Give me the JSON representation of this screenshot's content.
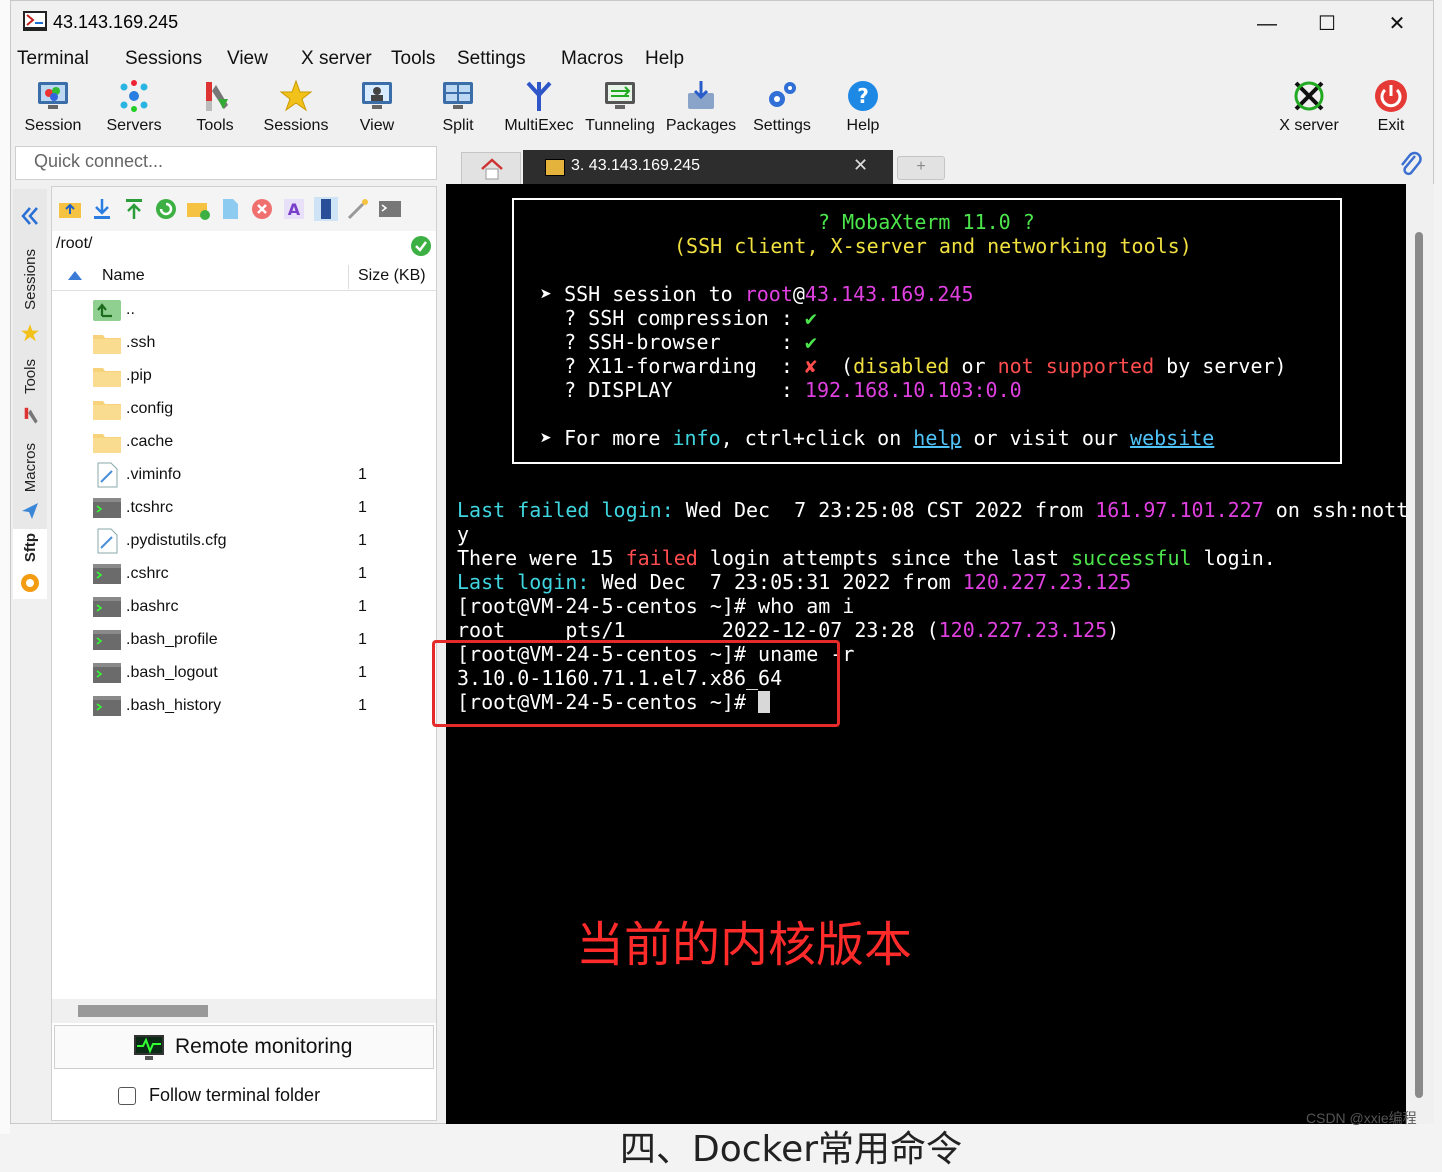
{
  "window": {
    "title": "43.143.169.245",
    "minimize": "—",
    "maximize": "☐",
    "close": "✕"
  },
  "menu": [
    "Terminal",
    "Sessions",
    "View",
    "X server",
    "Tools",
    "Settings",
    "Macros",
    "Help"
  ],
  "toolbar": {
    "session": "Session",
    "servers": "Servers",
    "tools": "Tools",
    "sessions": "Sessions",
    "view": "View",
    "split": "Split",
    "multiexec": "MultiExec",
    "tunneling": "Tunneling",
    "packages": "Packages",
    "settings": "Settings",
    "help": "Help",
    "xserver": "X server",
    "exit": "Exit"
  },
  "quick_connect": {
    "placeholder": "Quick connect..."
  },
  "side_tabs": [
    "Sessions",
    "Tools",
    "Macros",
    "Sftp"
  ],
  "sftp": {
    "path": "/root/",
    "col_name": "Name",
    "col_size": "Size (KB)",
    "files": [
      {
        "name": "..",
        "size": "",
        "type": "up"
      },
      {
        "name": ".ssh",
        "size": "",
        "type": "folder"
      },
      {
        "name": ".pip",
        "size": "",
        "type": "folder"
      },
      {
        "name": ".config",
        "size": "",
        "type": "folder"
      },
      {
        "name": ".cache",
        "size": "",
        "type": "folder"
      },
      {
        "name": ".viminfo",
        "size": "1",
        "type": "doc"
      },
      {
        "name": ".tcshrc",
        "size": "1",
        "type": "shell"
      },
      {
        "name": ".pydistutils.cfg",
        "size": "1",
        "type": "doc"
      },
      {
        "name": ".cshrc",
        "size": "1",
        "type": "shell"
      },
      {
        "name": ".bashrc",
        "size": "1",
        "type": "shell"
      },
      {
        "name": ".bash_profile",
        "size": "1",
        "type": "shell"
      },
      {
        "name": ".bash_logout",
        "size": "1",
        "type": "shell"
      },
      {
        "name": ".bash_history",
        "size": "1",
        "type": "shell"
      }
    ],
    "remote_monitoring": "Remote monitoring",
    "follow_folder": "Follow terminal folder"
  },
  "tab": {
    "title": "3. 43.143.169.245",
    "close": "✕",
    "new": "+"
  },
  "terminal": {
    "banner_title": "? MobaXterm 11.0 ?",
    "banner_sub": "(SSH client, X-server and networking tools)",
    "ssh_to": "➤ SSH session to ",
    "ssh_user": "root",
    "ssh_at": "@",
    "ssh_host": "43.143.169.245",
    "compression_label": "  ? SSH compression : ",
    "browser_label": "  ? SSH-browser     : ",
    "check": "✔",
    "x11_label": "  ? X11-forwarding  : ",
    "cross": "✘",
    "x11_open": "  (",
    "x11_disabled": "disabled",
    "x11_or": " or ",
    "x11_not": "not supported",
    "x11_by": " by server)",
    "display_label": "  ? DISPLAY         : ",
    "display_value": "192.168.10.103:0.0",
    "more_a": "➤ For more ",
    "more_info": "info",
    "more_b": ", ctrl+click on ",
    "more_help": "help",
    "more_c": " or visit our ",
    "more_website": "website",
    "lf_label": "Last failed login:",
    "lf_date": " Wed Dec  7 23:25:08 CST 2022 from ",
    "lf_ip": "161.97.101.227",
    "lf_on": " on ssh:nott",
    "lf_wrap": "y",
    "tw_a": "There were 15 ",
    "tw_failed": "failed",
    "tw_b": " login attempts since the last ",
    "tw_success": "successful",
    "tw_c": " login.",
    "ll_label": "Last login:",
    "ll_date": " Wed Dec  7 23:05:31 2022 from ",
    "ll_ip": "120.227.23.125",
    "cmd1": "[root@VM-24-5-centos ~]# who am i",
    "who_a": "root     pts/1        2022-12-07 23:28 (",
    "who_ip": "120.227.23.125",
    "who_b": ")",
    "cmd2": "[root@VM-24-5-centos ~]# uname -r",
    "kernel": "3.10.0-1160.71.1.el7.x86_64",
    "prompt": "[root@VM-24-5-centos ~]# "
  },
  "annotation": "当前的内核版本",
  "watermark": "CSDN @xxie编程",
  "colors": {
    "green": "#4ce64c",
    "cyan": "#3fd6e0",
    "magenta": "#e040e0",
    "red": "#ff4d4d",
    "yellow": "#f0e040",
    "link": "#4fc3f7"
  }
}
